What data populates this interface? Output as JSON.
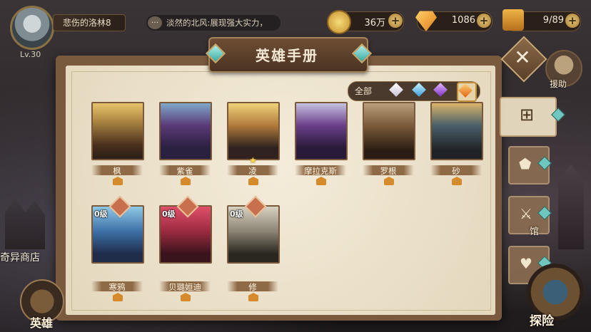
{
  "player": {
    "name": "悲伤的洛林8",
    "level": "Lv.30"
  },
  "chat": {
    "icon": "chat-bubble-icon",
    "text": "淡然的北风:展现强大实力，"
  },
  "resources": [
    {
      "name": "gold",
      "icon": "gold-coin-icon",
      "value": "36万",
      "color": "#e8b94a"
    },
    {
      "name": "diamond",
      "icon": "diamond-icon",
      "value": "1086",
      "color": "#f2a12c"
    },
    {
      "name": "stamina",
      "icon": "trophy-icon",
      "value": "9/89",
      "color": "#e6a03a"
    }
  ],
  "panel": {
    "title": "英雄手册"
  },
  "filter": {
    "all_label": "全部",
    "gems": [
      "white-gem-icon",
      "blue-gem-icon",
      "purple-gem-icon",
      "orange-gem-icon"
    ],
    "selected": "orange-gem-icon"
  },
  "heroes": [
    {
      "name": "枫",
      "level": "",
      "star": false,
      "pin": false
    },
    {
      "name": "紫雀",
      "level": "",
      "star": false,
      "pin": false
    },
    {
      "name": "凌",
      "level": "",
      "star": true,
      "pin": false
    },
    {
      "name": "摩拉克斯",
      "level": "",
      "star": false,
      "pin": false
    },
    {
      "name": "罗根",
      "level": "",
      "star": false,
      "pin": false
    },
    {
      "name": "砂",
      "level": "",
      "star": false,
      "pin": false
    },
    {
      "name": "寒鸦",
      "level": "0级",
      "star": false,
      "pin": true
    },
    {
      "name": "贝璐姮迪",
      "level": "0级",
      "star": false,
      "pin": true
    },
    {
      "name": "修",
      "level": "0级",
      "star": false,
      "pin": true
    }
  ],
  "right_nav": {
    "help_label": "援助",
    "arena_label": "馆",
    "explore_label": "探险"
  },
  "left_nav": {
    "shop_label": "奇异商店",
    "hero_label": "英雄"
  }
}
